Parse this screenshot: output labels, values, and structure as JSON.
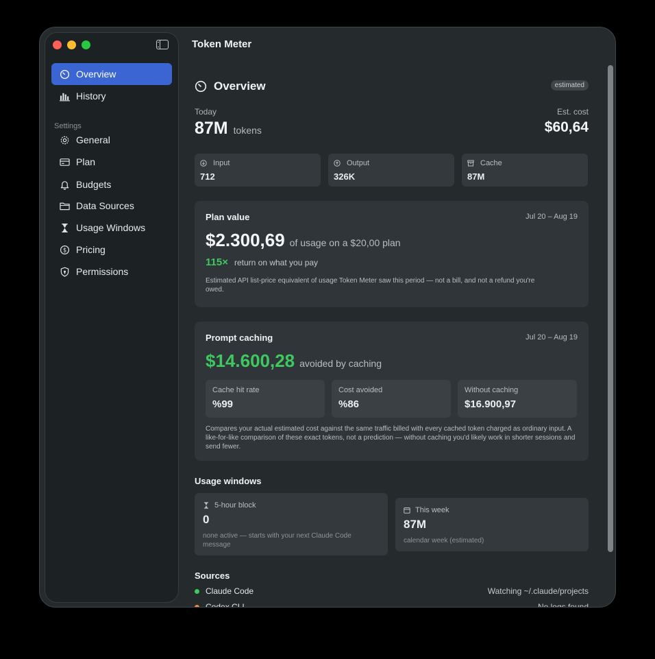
{
  "app": {
    "title": "Token Meter"
  },
  "sidebar": {
    "section_label": "Settings",
    "items": [
      {
        "label": "Overview",
        "icon": "gauge-icon",
        "active": true
      },
      {
        "label": "History",
        "icon": "bar-chart-icon"
      },
      {
        "label": "General",
        "icon": "gear-icon"
      },
      {
        "label": "Plan",
        "icon": "credit-card-icon"
      },
      {
        "label": "Budgets",
        "icon": "bell-icon"
      },
      {
        "label": "Data Sources",
        "icon": "folder-icon"
      },
      {
        "label": "Usage Windows",
        "icon": "hourglass-icon"
      },
      {
        "label": "Pricing",
        "icon": "dollar-circle-icon"
      },
      {
        "label": "Permissions",
        "icon": "shield-icon"
      }
    ]
  },
  "overview": {
    "title": "Overview",
    "badge": "estimated",
    "today_label": "Today",
    "today_value": "87M",
    "today_unit": "tokens",
    "cost_label": "Est. cost",
    "cost_value": "$60,64",
    "stats": [
      {
        "label": "Input",
        "value": "712",
        "icon": "input-icon"
      },
      {
        "label": "Output",
        "value": "326K",
        "icon": "output-icon"
      },
      {
        "label": "Cache",
        "value": "87M",
        "icon": "archive-icon"
      }
    ]
  },
  "plan_value": {
    "title": "Plan value",
    "date_range": "Jul 20 – Aug 19",
    "amount": "$2.300,69",
    "suffix": "of usage on a $20,00 plan",
    "ratio": "115×",
    "ratio_text": "return on what you pay",
    "note": "Estimated API list-price equivalent of usage Token Meter saw this period — not a bill, and not a refund you're owed."
  },
  "prompt_caching": {
    "title": "Prompt caching",
    "date_range": "Jul 20 – Aug 19",
    "amount": "$14.600,28",
    "suffix": "avoided by caching",
    "stats": [
      {
        "label": "Cache hit rate",
        "value": "%99"
      },
      {
        "label": "Cost avoided",
        "value": "%86"
      },
      {
        "label": "Without caching",
        "value": "$16.900,97"
      }
    ],
    "note": "Compares your actual estimated cost against the same traffic billed with every cached token charged as ordinary input. A like-for-like comparison of these exact tokens, not a prediction — without caching you'd likely work in shorter sessions and send fewer."
  },
  "usage_windows": {
    "title": "Usage windows",
    "block": {
      "label": "5-hour block",
      "value": "0",
      "desc": "none active — starts with your next Claude Code message"
    },
    "week": {
      "label": "This week",
      "value": "87M",
      "desc": "calendar week (estimated)"
    }
  },
  "sources": {
    "title": "Sources",
    "items": [
      {
        "name": "Claude Code",
        "status": "Watching ~/.claude/projects",
        "color": "#3fc860"
      },
      {
        "name": "Codex CLI",
        "status": "No logs found",
        "color": "#f0883e"
      }
    ]
  },
  "colors": {
    "accent": "#3a65d3",
    "positive": "#3fc860",
    "warning": "#f0883e"
  }
}
